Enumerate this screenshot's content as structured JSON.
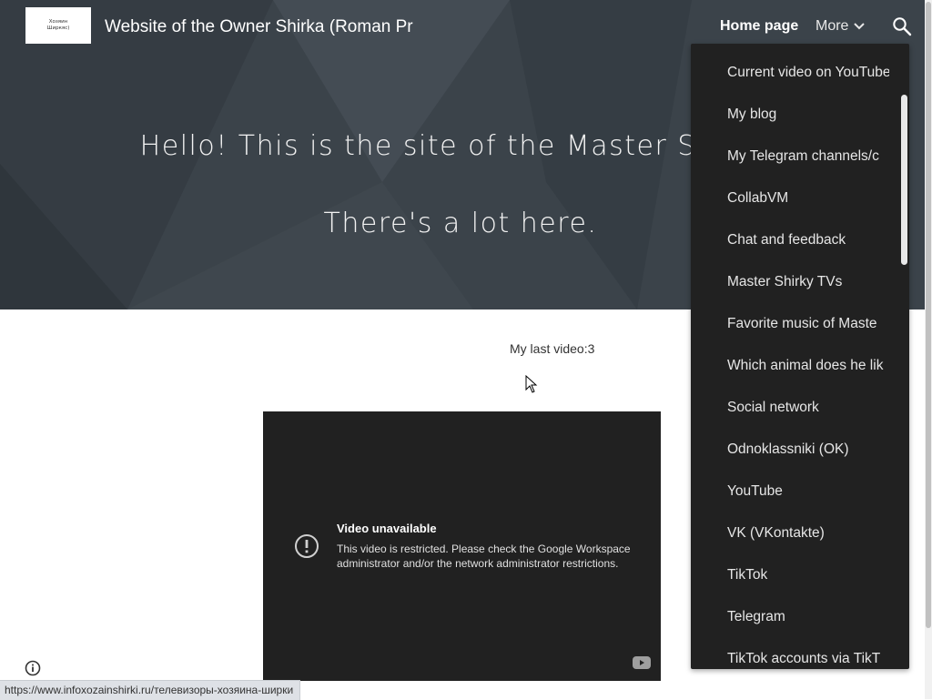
{
  "header": {
    "logo_text": "Хозяин Ширкяс)",
    "site_title": "Website of the Owner Shirka (Roman Pr",
    "nav": {
      "home_label": "Home page",
      "more_label": "More"
    }
  },
  "hero": {
    "text": "Hello! This is the site of the Master Shirka. There's a lot here."
  },
  "content": {
    "last_video_label": "My last video:3",
    "video": {
      "title": "Video unavailable",
      "message": "This video is restricted. Please check the Google Workspace administrator and/or the network administrator restrictions."
    }
  },
  "dropdown": {
    "items": [
      "Current video on YouTube",
      "My blog",
      "My Telegram channels/c",
      "CollabVM",
      "Chat and feedback",
      "Master Shirky TVs",
      "Favorite music of Maste",
      "Which animal does he lik",
      "Social network",
      "Odnoklassniki (OK)",
      "YouTube",
      "VK (VKontakte)",
      "TikTok",
      "Telegram",
      "TikTok accounts via TikT"
    ]
  },
  "status_bar": {
    "url": "https://www.infoxozainshirki.ru/телевизоры-хозяина-ширки"
  },
  "icons": {
    "search": "search-icon",
    "more": "chevron-down-icon",
    "alert": "alert-circle-icon",
    "info": "info-icon",
    "youtube": "youtube-logo-icon",
    "cursor": "mouse-pointer-icon"
  },
  "colors": {
    "hero_background": "#3b434a",
    "dropdown_background": "#212121",
    "video_background": "#212121"
  }
}
